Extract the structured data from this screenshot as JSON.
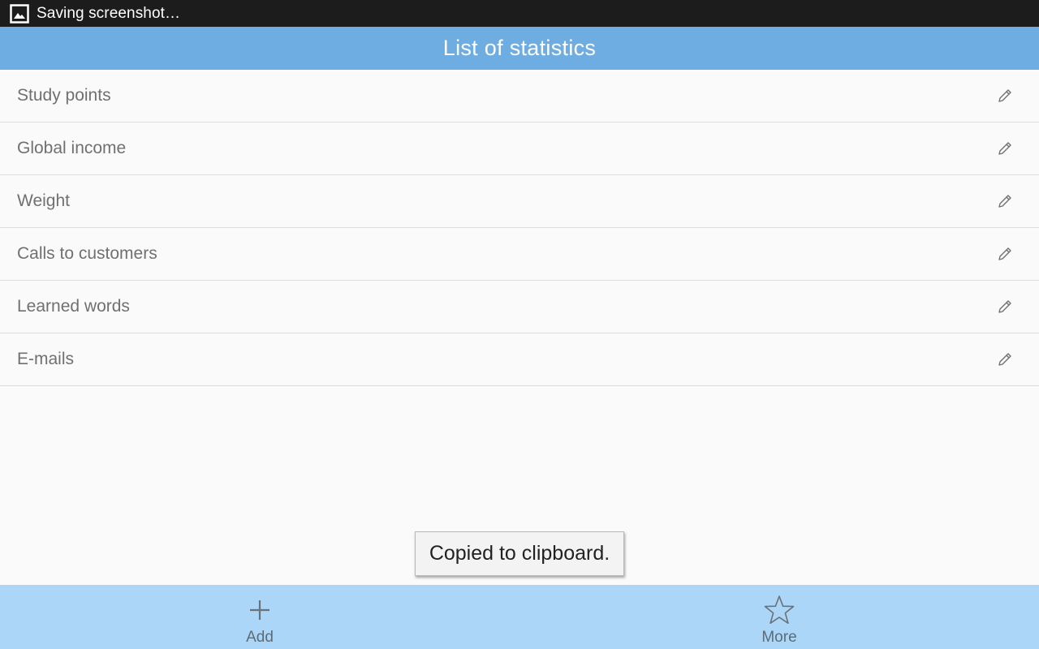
{
  "status_bar": {
    "notification_icon": "screenshot-image-icon",
    "text": "Saving screenshot…"
  },
  "action_bar": {
    "title": "List of statistics"
  },
  "list": {
    "items": [
      {
        "label": "Study points",
        "action_icon": "pencil-edit-icon"
      },
      {
        "label": "Global income",
        "action_icon": "pencil-edit-icon"
      },
      {
        "label": "Weight",
        "action_icon": "pencil-edit-icon"
      },
      {
        "label": "Calls to customers",
        "action_icon": "pencil-edit-icon"
      },
      {
        "label": "Learned words",
        "action_icon": "pencil-edit-icon"
      },
      {
        "label": "E-mails",
        "action_icon": "pencil-edit-icon"
      }
    ]
  },
  "toast": {
    "message": "Copied to clipboard."
  },
  "bottom_bar": {
    "add_label": "Add",
    "add_icon": "plus-icon",
    "more_label": "More",
    "more_icon": "star-icon"
  },
  "colors": {
    "status_bar_bg": "#1c1c1c",
    "action_bar_bg": "#6eade2",
    "bottom_bar_bg": "#acd6f8",
    "list_text": "#707070"
  }
}
